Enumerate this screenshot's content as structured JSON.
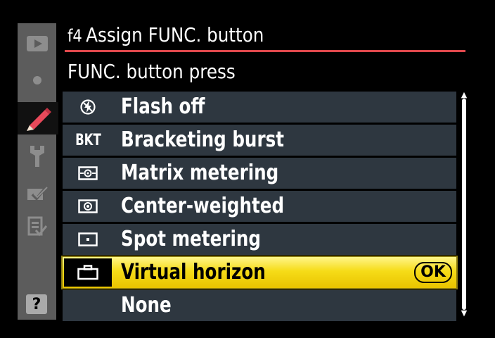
{
  "header": {
    "code": "f4",
    "title": "Assign FUNC. button"
  },
  "subtitle": "FUNC. button press",
  "side_tabs": [
    {
      "icon": "playback-icon",
      "active": false
    },
    {
      "icon": "camera-icon",
      "active": false
    },
    {
      "icon": "pencil-icon",
      "active": true
    },
    {
      "icon": "wrench-icon",
      "active": false
    },
    {
      "icon": "retouch-icon",
      "active": false
    },
    {
      "icon": "my-menu-icon",
      "active": false
    }
  ],
  "help_label": "?",
  "options": [
    {
      "label": "Flash off",
      "icon": "flash-off-icon",
      "icon_text": ""
    },
    {
      "label": "Bracketing burst",
      "icon": "bkt-icon",
      "icon_text": "BKT"
    },
    {
      "label": "Matrix metering",
      "icon": "matrix-metering-icon",
      "icon_text": ""
    },
    {
      "label": "Center-weighted",
      "icon": "center-weighted-icon",
      "icon_text": ""
    },
    {
      "label": "Spot metering",
      "icon": "spot-metering-icon",
      "icon_text": ""
    },
    {
      "label": "Virtual horizon",
      "icon": "virtual-horizon-icon",
      "icon_text": "",
      "selected": true
    },
    {
      "label": "None",
      "icon": "",
      "icon_text": ""
    }
  ],
  "ok_label": "OK",
  "colors": {
    "accent_rule": "#e0484c",
    "highlight": "#f6dc18",
    "row_bg": "#2e3740",
    "tab_bg": "#5c5c5c"
  }
}
